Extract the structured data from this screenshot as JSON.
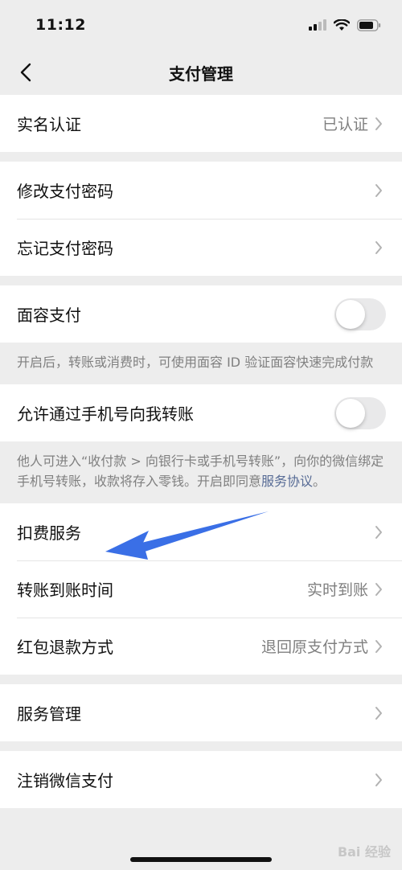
{
  "status_bar": {
    "time": "11:12"
  },
  "nav": {
    "title": "支付管理"
  },
  "section_realname": {
    "label": "实名认证",
    "value": "已认证"
  },
  "section_password": {
    "change_label": "修改支付密码",
    "forgot_label": "忘记支付密码"
  },
  "section_face": {
    "label": "面容支付",
    "toggle_on": false,
    "note": "开启后，转账或消费时，可使用面容 ID 验证面容快速完成付款"
  },
  "section_phone": {
    "label": "允许通过手机号向我转账",
    "toggle_on": false,
    "note_text": "他人可进入“收付款 > 向银行卡或手机号转账”，向你的微信绑定手机号转账，收款将存入零钱。开启即同意",
    "note_link": "服务协议",
    "note_end": "。"
  },
  "section_services": {
    "deduction_label": "扣费服务",
    "arrival_label": "转账到账时间",
    "arrival_value": "实时到账",
    "refund_label": "红包退款方式",
    "refund_value": "退回原支付方式"
  },
  "section_manage": {
    "label": "服务管理"
  },
  "section_cancel": {
    "label": "注销微信支付"
  },
  "watermark": {
    "text": "Bai 经验"
  },
  "colors": {
    "background": "#ededed",
    "link": "#576b95",
    "annotation_arrow": "#3a6fe6"
  },
  "icons": [
    "back-arrow-icon",
    "chevron-right-icon",
    "signal-icon",
    "wifi-icon",
    "battery-icon"
  ]
}
